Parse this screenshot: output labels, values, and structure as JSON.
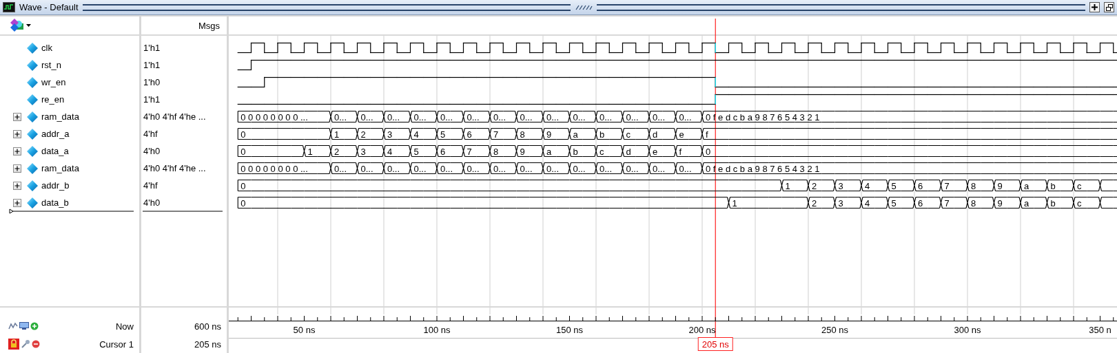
{
  "window": {
    "title": "Wave - Default"
  },
  "header": {
    "values_heading": "Msgs"
  },
  "signals": [
    {
      "name": "clk",
      "value": "1'h1",
      "expandable": false,
      "kind": "bit",
      "high": [
        false,
        true,
        false,
        true,
        false,
        true,
        false,
        true,
        false,
        true,
        false,
        true,
        false,
        true,
        false,
        true,
        false,
        true,
        false,
        true,
        false,
        true,
        false,
        true,
        false,
        true,
        false,
        true,
        false,
        true,
        false,
        true,
        false,
        true,
        false,
        true,
        false,
        true,
        false,
        true,
        false,
        true,
        false,
        true,
        false,
        true,
        false,
        true,
        false,
        true,
        false,
        true,
        false,
        true,
        false,
        true,
        false,
        true,
        false,
        true,
        false,
        true,
        false,
        true,
        false,
        true,
        false
      ]
    },
    {
      "name": "rst_n",
      "value": "1'h1",
      "expandable": false,
      "kind": "bit",
      "high": [
        false,
        true,
        true,
        true,
        true,
        true,
        true,
        true,
        true,
        true,
        true,
        true,
        true,
        true,
        true,
        true,
        true,
        true,
        true,
        true,
        true,
        true,
        true,
        true,
        true,
        true,
        true,
        true,
        true,
        true,
        true,
        true,
        true,
        true,
        true,
        true,
        true,
        true,
        true,
        true,
        true,
        true,
        true,
        true,
        true,
        true,
        true,
        true,
        true,
        true,
        true,
        true,
        true,
        true,
        true,
        true,
        true,
        true,
        true,
        true,
        true,
        true,
        true,
        true,
        true,
        true,
        true
      ]
    },
    {
      "name": "wr_en",
      "value": "1'h0",
      "expandable": false,
      "kind": "bit",
      "high": [
        false,
        false,
        true,
        true,
        true,
        true,
        true,
        true,
        true,
        true,
        true,
        true,
        true,
        true,
        true,
        true,
        true,
        true,
        true,
        true,
        true,
        true,
        true,
        true,
        true,
        true,
        true,
        true,
        true,
        true,
        true,
        true,
        true,
        true,
        true,
        true,
        false,
        false,
        false,
        false,
        false,
        false,
        false,
        false,
        false,
        false,
        false,
        false,
        false,
        false,
        false,
        false,
        false,
        false,
        false,
        false,
        false,
        false,
        false,
        false,
        false,
        false,
        false,
        false,
        false,
        false,
        false
      ]
    },
    {
      "name": "re_en",
      "value": "1'h1",
      "expandable": false,
      "kind": "bit",
      "high": [
        false,
        false,
        false,
        false,
        false,
        false,
        false,
        false,
        false,
        false,
        false,
        false,
        false,
        false,
        false,
        false,
        false,
        false,
        false,
        false,
        false,
        false,
        false,
        false,
        false,
        false,
        false,
        false,
        false,
        false,
        false,
        false,
        false,
        false,
        false,
        false,
        true,
        true,
        true,
        true,
        true,
        true,
        true,
        true,
        true,
        true,
        true,
        true,
        true,
        true,
        true,
        true,
        true,
        true,
        true,
        true,
        true,
        true,
        true,
        true,
        true,
        true,
        true,
        true,
        true,
        true,
        true
      ]
    },
    {
      "name": "ram_data",
      "value": "4'h0 4'hf 4'he ...",
      "expandable": true,
      "kind": "bus",
      "edges": [
        true,
        false,
        false,
        false,
        false,
        false,
        false,
        true,
        false,
        true,
        false,
        true,
        false,
        true,
        false,
        true,
        false,
        true,
        false,
        true,
        false,
        true,
        false,
        true,
        false,
        true,
        false,
        true,
        false,
        true,
        false,
        true,
        false,
        true,
        false,
        true,
        false,
        false,
        false,
        false,
        false,
        false,
        false,
        false,
        false,
        false,
        false,
        false,
        false,
        false,
        false,
        false,
        false,
        false,
        false,
        false,
        false,
        false,
        false,
        false,
        false,
        false,
        false,
        false,
        false,
        false,
        false
      ],
      "segments": [
        "0 0 0 0 0 0 0 0 ...",
        "0...",
        "0...",
        "0...",
        "0...",
        "0...",
        "0...",
        "0...",
        "0...",
        "0...",
        "0...",
        "0...",
        "0...",
        "0...",
        "0...",
        "0 f e d c b a 9 8 7 6 5 4 3 2 1"
      ]
    },
    {
      "name": "addr_a",
      "value": "4'hf",
      "expandable": true,
      "kind": "bus",
      "edges": [
        true,
        false,
        false,
        false,
        false,
        false,
        false,
        true,
        false,
        true,
        false,
        true,
        false,
        true,
        false,
        true,
        false,
        true,
        false,
        true,
        false,
        true,
        false,
        true,
        false,
        true,
        false,
        true,
        false,
        true,
        false,
        true,
        false,
        true,
        false,
        true,
        false,
        false,
        false,
        false,
        false,
        false,
        false,
        false,
        false,
        false,
        false,
        false,
        false,
        false,
        false,
        false,
        false,
        false,
        false,
        false,
        false,
        false,
        false,
        false,
        false,
        false,
        false,
        false,
        false,
        false,
        false
      ],
      "segments": [
        "0",
        "1",
        "2",
        "3",
        "4",
        "5",
        "6",
        "7",
        "8",
        "9",
        "a",
        "b",
        "c",
        "d",
        "e",
        "f"
      ]
    },
    {
      "name": "data_a",
      "value": "4'h0",
      "expandable": true,
      "kind": "bus",
      "edges": [
        true,
        false,
        false,
        false,
        false,
        true,
        false,
        true,
        false,
        true,
        false,
        true,
        false,
        true,
        false,
        true,
        false,
        true,
        false,
        true,
        false,
        true,
        false,
        true,
        false,
        true,
        false,
        true,
        false,
        true,
        false,
        true,
        false,
        true,
        false,
        true,
        false,
        false,
        false,
        false,
        false,
        false,
        false,
        false,
        false,
        false,
        false,
        false,
        false,
        false,
        false,
        false,
        false,
        false,
        false,
        false,
        false,
        false,
        false,
        false,
        false,
        false,
        false,
        false,
        false,
        false,
        false
      ],
      "segments": [
        "0",
        "1",
        "2",
        "3",
        "4",
        "5",
        "6",
        "7",
        "8",
        "9",
        "a",
        "b",
        "c",
        "d",
        "e",
        "f",
        "0"
      ]
    },
    {
      "name": "ram_data",
      "value": "4'h0 4'hf 4'he ...",
      "expandable": true,
      "kind": "bus",
      "edges": [
        true,
        false,
        false,
        false,
        false,
        false,
        false,
        true,
        false,
        true,
        false,
        true,
        false,
        true,
        false,
        true,
        false,
        true,
        false,
        true,
        false,
        true,
        false,
        true,
        false,
        true,
        false,
        true,
        false,
        true,
        false,
        true,
        false,
        true,
        false,
        true,
        false,
        false,
        false,
        false,
        false,
        false,
        false,
        false,
        false,
        false,
        false,
        false,
        false,
        false,
        false,
        false,
        false,
        false,
        false,
        false,
        false,
        false,
        false,
        false,
        false,
        false,
        false,
        false,
        false,
        false,
        false
      ],
      "segments": [
        "0 0 0 0 0 0 0 0 ...",
        "0...",
        "0...",
        "0...",
        "0...",
        "0...",
        "0...",
        "0...",
        "0...",
        "0...",
        "0...",
        "0...",
        "0...",
        "0...",
        "0...",
        "0 f e d c b a 9 8 7 6 5 4 3 2 1"
      ]
    },
    {
      "name": "addr_b",
      "value": "4'hf",
      "expandable": true,
      "kind": "bus",
      "edges": [
        true,
        false,
        false,
        false,
        false,
        false,
        false,
        false,
        false,
        false,
        false,
        false,
        false,
        false,
        false,
        false,
        false,
        false,
        false,
        false,
        false,
        false,
        false,
        false,
        false,
        false,
        false,
        false,
        false,
        false,
        false,
        false,
        false,
        false,
        false,
        false,
        false,
        false,
        false,
        false,
        false,
        true,
        false,
        true,
        false,
        true,
        false,
        true,
        false,
        true,
        false,
        true,
        false,
        true,
        false,
        true,
        false,
        true,
        false,
        true,
        false,
        true,
        false,
        true,
        false,
        true,
        false
      ],
      "segments": [
        "0",
        "1",
        "2",
        "3",
        "4",
        "5",
        "6",
        "7",
        "8",
        "9",
        "a",
        "b",
        "c"
      ]
    },
    {
      "name": "data_b",
      "value": "4'h0",
      "expandable": true,
      "kind": "bus",
      "edges": [
        true,
        false,
        false,
        false,
        false,
        false,
        false,
        false,
        false,
        false,
        false,
        false,
        false,
        false,
        false,
        false,
        false,
        false,
        false,
        false,
        false,
        false,
        false,
        false,
        false,
        false,
        false,
        false,
        false,
        false,
        false,
        false,
        false,
        false,
        false,
        false,
        false,
        true,
        false,
        false,
        false,
        false,
        false,
        true,
        false,
        true,
        false,
        true,
        false,
        true,
        false,
        true,
        false,
        true,
        false,
        true,
        false,
        true,
        false,
        true,
        false,
        true,
        false,
        true,
        false,
        true,
        false
      ],
      "segments": [
        "0",
        "1",
        "2",
        "3",
        "4",
        "5",
        "6",
        "7",
        "8",
        "9",
        "a",
        "b",
        "c"
      ]
    }
  ],
  "timeline": {
    "ticks": [
      "50 ns",
      "100 ns",
      "150 ns",
      "200 ns",
      "250 ns",
      "300 ns",
      "350 n"
    ]
  },
  "footer": {
    "now": {
      "label": "Now",
      "value": "600 ns"
    },
    "cursor": {
      "label": "Cursor 1",
      "value": "205 ns",
      "marker": "205 ns",
      "locked": true
    }
  }
}
